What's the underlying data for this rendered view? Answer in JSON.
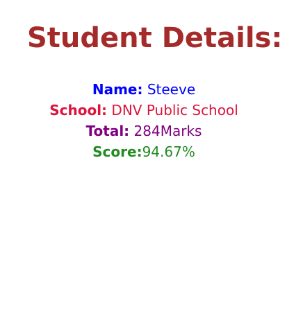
{
  "heading": "Student Details:",
  "details": [
    {
      "label": "Name:",
      "value": "Steeve",
      "color": "#0000FF",
      "gap": true
    },
    {
      "label": "School:",
      "value": "DNV Public School",
      "color": "#DC143C",
      "gap": true
    },
    {
      "label": "Total:",
      "value": "284Marks",
      "color": "#800080",
      "gap": true
    },
    {
      "label": "Score:",
      "value": "94.67%",
      "color": "#228B22",
      "gap": false
    }
  ]
}
